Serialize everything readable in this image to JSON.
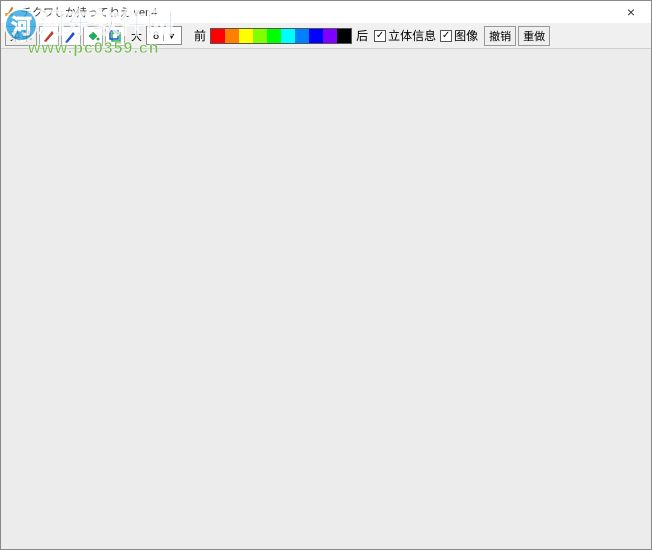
{
  "window": {
    "title": "チクワしか持ってねえ ver.4",
    "close_symbol": "×"
  },
  "toolbar": {
    "menu_label": "菜单",
    "size_label": "大",
    "size_value": "8",
    "front_label": "前",
    "back_label": "后",
    "info3d_label": "立体信息",
    "image_label": "图像",
    "undo_label": "撤销",
    "redo_label": "重做",
    "check_info3d": "✓",
    "check_image": "✓"
  },
  "palette": [
    "#ff0000",
    "#ff8000",
    "#ffff00",
    "#80ff00",
    "#00ff00",
    "#00ffff",
    "#0080ff",
    "#0000ff",
    "#8000ff",
    "#000000"
  ],
  "tool_icons": {
    "pen": "pen-icon",
    "brush": "brush-icon",
    "fill": "fill-icon",
    "shape": "shape-icon"
  },
  "watermark": {
    "main": "河东软件园",
    "sub": "www.pc0359.cn"
  }
}
